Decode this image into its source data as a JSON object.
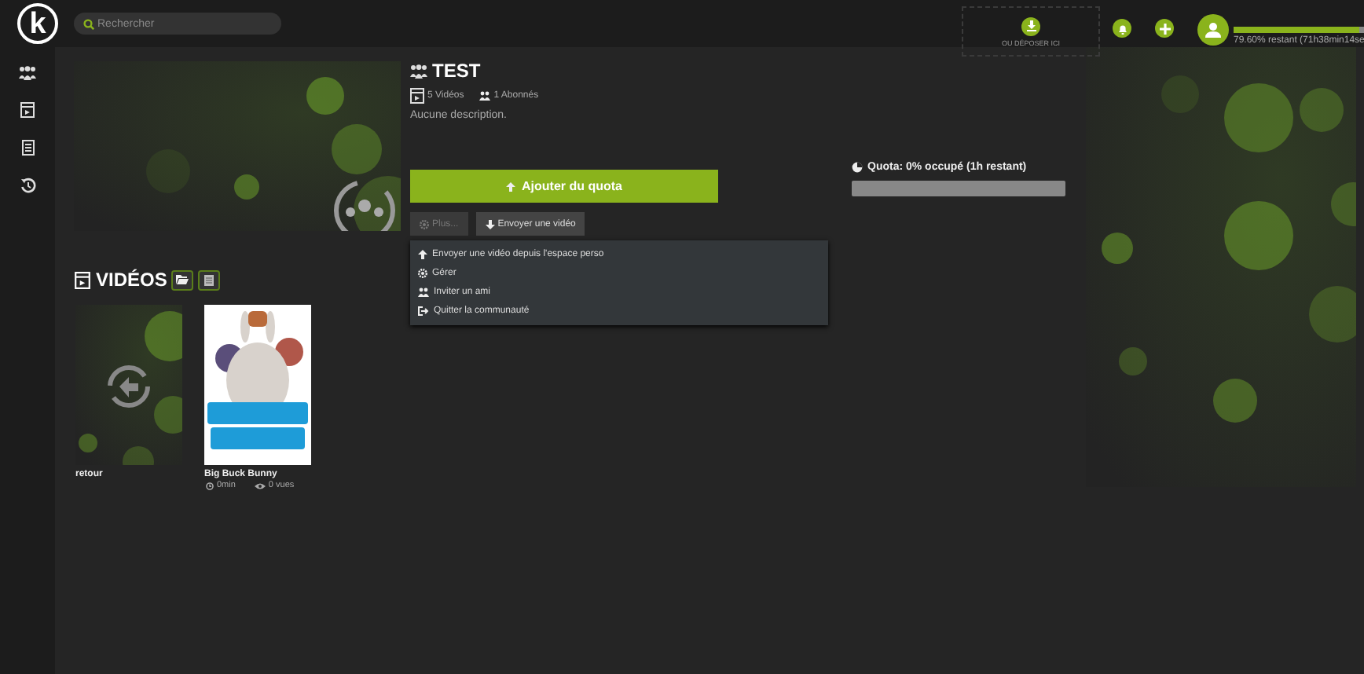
{
  "header": {
    "logo": "k",
    "search": {
      "placeholder": "Rechercher"
    },
    "dropzone": "OU DÉPOSER ICI",
    "quota": {
      "level": 0.796,
      "text": "79.60% restant (71h38min14se"
    }
  },
  "sidebar": {
    "items": [
      {
        "kind": "community"
      },
      {
        "kind": "videos"
      },
      {
        "kind": "document"
      },
      {
        "kind": "history"
      }
    ]
  },
  "community": {
    "title": "TEST",
    "videos": "5 Vidéos",
    "subscribers": "1 Abonnés",
    "description": "Aucune description.",
    "add_quota": "Ajouter du quota",
    "more": {
      "label": "Plus...",
      "disabled": true
    },
    "upload": "Envoyer une vidéo",
    "menu": [
      {
        "kind": "upload",
        "label": "Envoyer une vidéo depuis l'espace perso"
      },
      {
        "kind": "manage",
        "label": "Gérer"
      },
      {
        "kind": "invite",
        "label": "Inviter un ami"
      },
      {
        "kind": "leave",
        "label": "Quitter la communauté"
      }
    ]
  },
  "quota": {
    "label": "Quota: 0% occupé (1h restant)",
    "level": 0
  },
  "videos": {
    "title": "VIDÉOS",
    "items": [
      {
        "kind": "back",
        "title": "retour"
      },
      {
        "kind": "video",
        "title": "Big Buck Bunny",
        "duration": "0min",
        "views": "0 vues"
      }
    ]
  }
}
